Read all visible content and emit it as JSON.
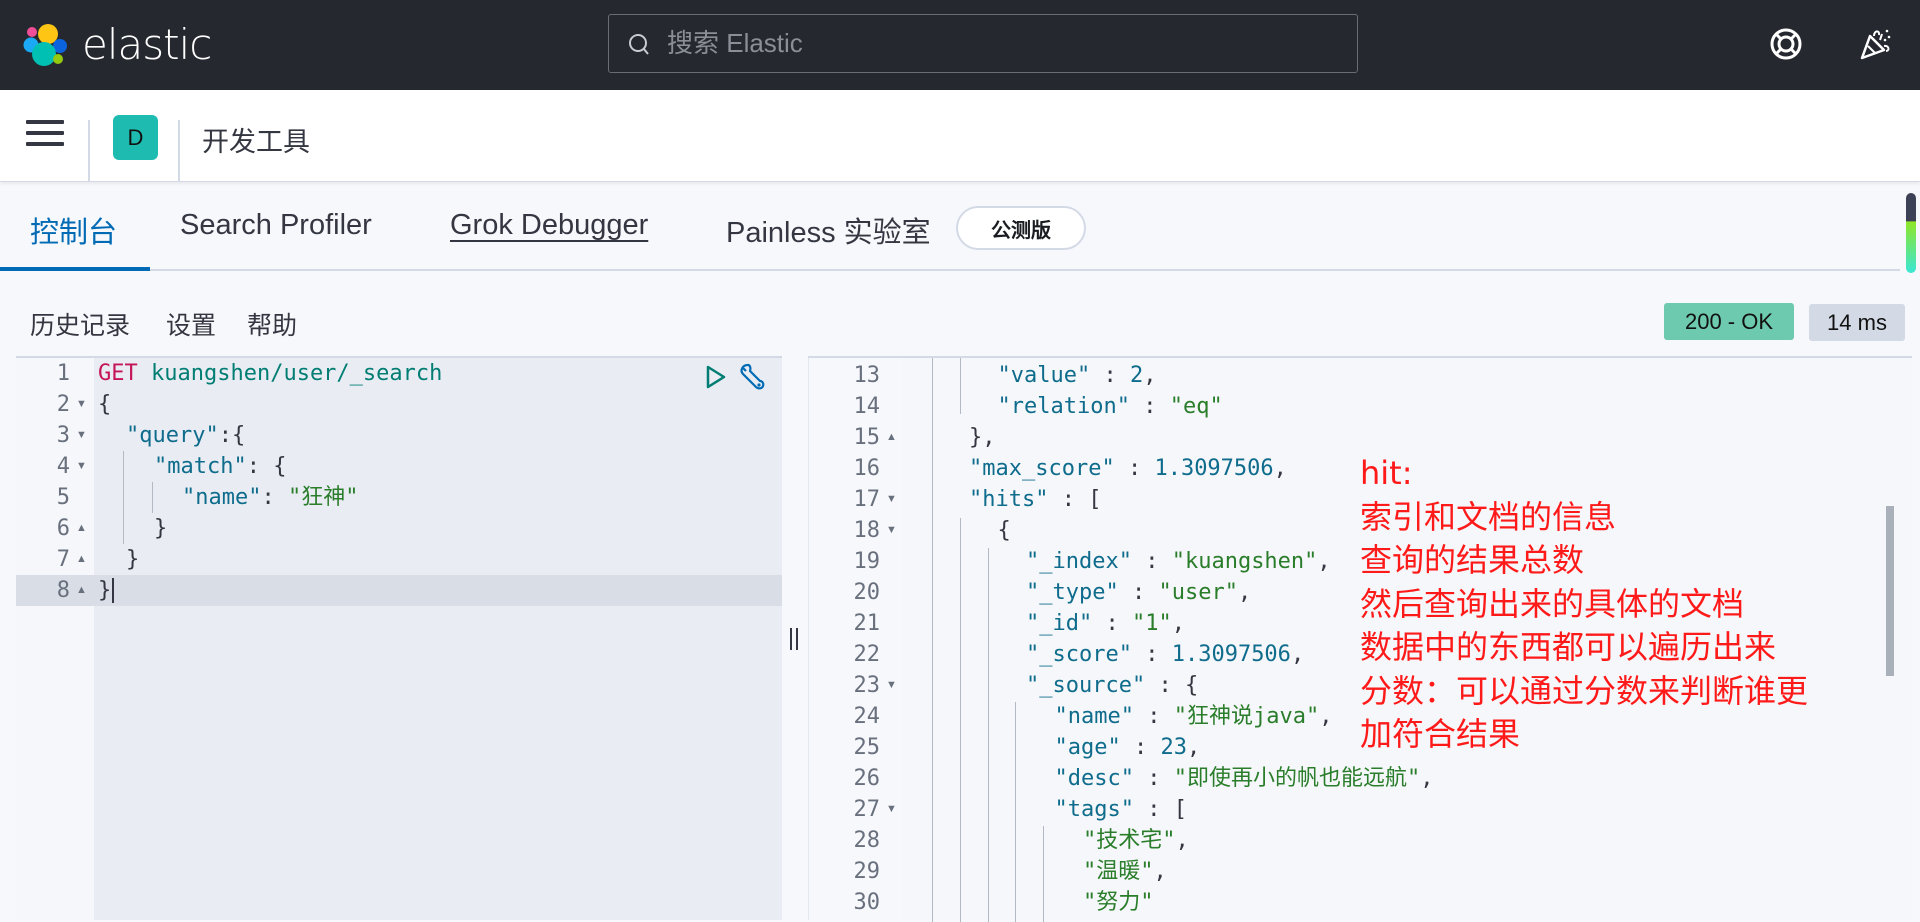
{
  "header": {
    "brand": "elastic",
    "search_placeholder": "搜索 Elastic",
    "icons": [
      "help-lifebuoy-icon",
      "news-party-popper-icon"
    ]
  },
  "subheader": {
    "app_badge": "D",
    "title": "开发工具"
  },
  "tabs": [
    {
      "label": "控制台",
      "active": true
    },
    {
      "label": "Search Profiler",
      "active": false
    },
    {
      "label": "Grok Debugger",
      "active": false
    },
    {
      "label": "Painless 实验室",
      "active": false,
      "badge": "公测版"
    }
  ],
  "actions": {
    "history": "历史记录",
    "settings": "设置",
    "help": "帮助"
  },
  "status": {
    "code": "200 - OK",
    "time": "14 ms",
    "code_color": "#6dcaae"
  },
  "request_editor": {
    "line_numbers": [
      "1",
      "2",
      "3",
      "4",
      "5",
      "6",
      "7",
      "8"
    ],
    "lines": [
      {
        "method": "GET",
        "url": "kuangshen/user/_search"
      },
      {
        "text": "{"
      },
      {
        "key": "\"query\"",
        "rest": ":{"
      },
      {
        "key": "\"match\"",
        "rest": ": {"
      },
      {
        "key": "\"name\"",
        "rest": ": ",
        "str": "\"狂神\""
      },
      {
        "text": "}"
      },
      {
        "text": "}"
      },
      {
        "text": "}"
      }
    ]
  },
  "response_editor": {
    "line_numbers": [
      "13",
      "14",
      "15",
      "16",
      "17",
      "18",
      "19",
      "20",
      "21",
      "22",
      "23",
      "24",
      "25",
      "26",
      "27",
      "28",
      "29",
      "30"
    ],
    "lines": {
      "l13": {
        "key": "\"value\"",
        "sep": " : ",
        "num": "2",
        "end": ","
      },
      "l14": {
        "key": "\"relation\"",
        "sep": " : ",
        "str": "\"eq\""
      },
      "l15": {
        "text": "},"
      },
      "l16": {
        "key": "\"max_score\"",
        "sep": " : ",
        "num": "1.3097506",
        "end": ","
      },
      "l17": {
        "key": "\"hits\"",
        "sep": " : ["
      },
      "l18": {
        "text": "{"
      },
      "l19": {
        "key": "\"_index\"",
        "sep": " : ",
        "str": "\"kuangshen\"",
        "end": ","
      },
      "l20": {
        "key": "\"_type\"",
        "sep": " : ",
        "str": "\"user\"",
        "end": ","
      },
      "l21": {
        "key": "\"_id\"",
        "sep": " : ",
        "str": "\"1\"",
        "end": ","
      },
      "l22": {
        "key": "\"_score\"",
        "sep": " : ",
        "num": "1.3097506",
        "end": ","
      },
      "l23": {
        "key": "\"_source\"",
        "sep": " : {"
      },
      "l24": {
        "key": "\"name\"",
        "sep": " : ",
        "str": "\"狂神说java\"",
        "end": ","
      },
      "l25": {
        "key": "\"age\"",
        "sep": " : ",
        "num": "23",
        "end": ","
      },
      "l26": {
        "key": "\"desc\"",
        "sep": " : ",
        "str": "\"即使再小的帆也能远航\"",
        "end": ","
      },
      "l27": {
        "key": "\"tags\"",
        "sep": " : ["
      },
      "l28": {
        "str": "\"技术宅\"",
        "end": ","
      },
      "l29": {
        "str": "\"温暖\"",
        "end": ","
      },
      "l30": {
        "str": "\"努力\""
      }
    }
  },
  "annotation": {
    "lines": [
      "hit:",
      "索引和文档的信息",
      "查询的结果总数",
      "然后查询出来的具体的文档",
      "数据中的东西都可以遍历出来",
      "分数：可以通过分数来判断谁更",
      "加符合结果"
    ],
    "color": "#ff1a1a"
  }
}
